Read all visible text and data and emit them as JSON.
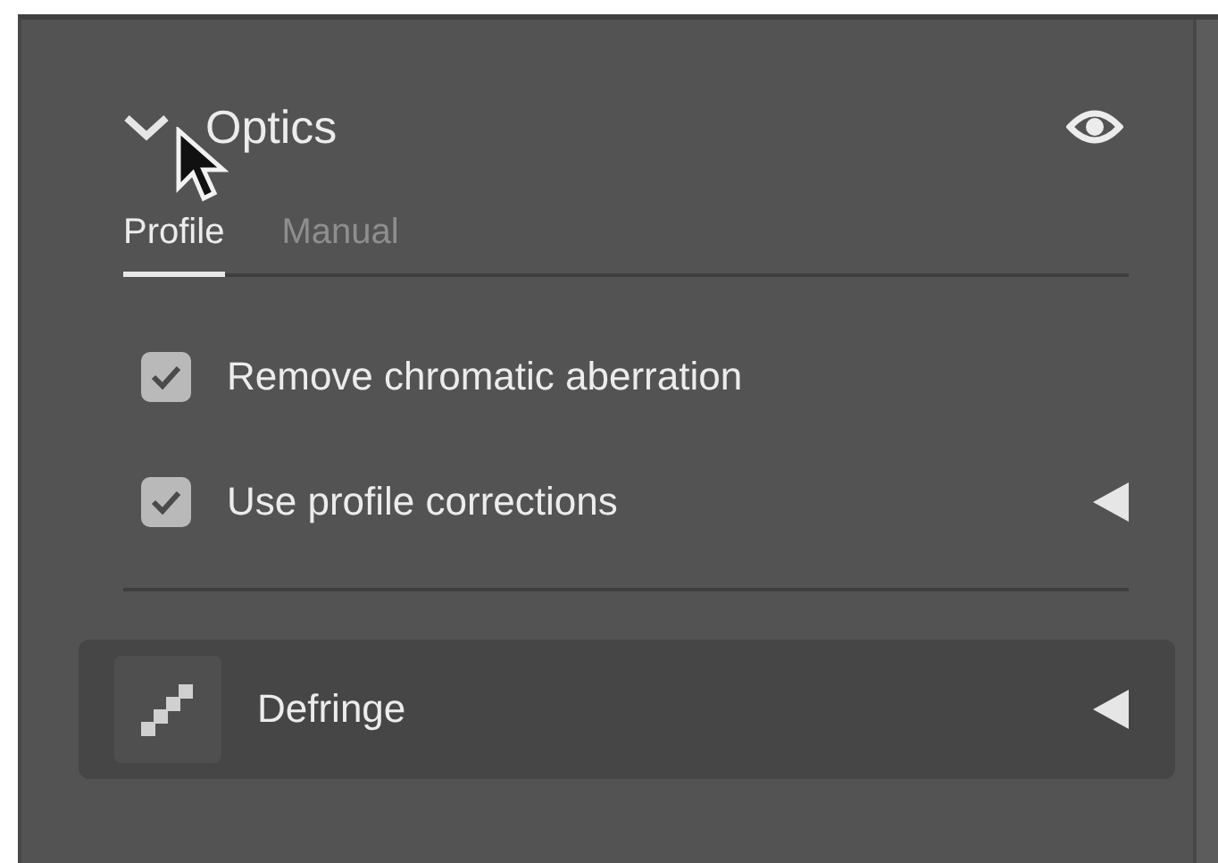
{
  "section": {
    "title": "Optics",
    "expanded": true,
    "visible": true
  },
  "tabs": [
    {
      "label": "Profile",
      "selected": true
    },
    {
      "label": "Manual",
      "selected": false
    }
  ],
  "options": [
    {
      "label": "Remove chromatic aberration",
      "checked": true,
      "has_disclosure": false
    },
    {
      "label": "Use profile corrections",
      "checked": true,
      "has_disclosure": true
    }
  ],
  "subsection": {
    "label": "Defringe"
  }
}
